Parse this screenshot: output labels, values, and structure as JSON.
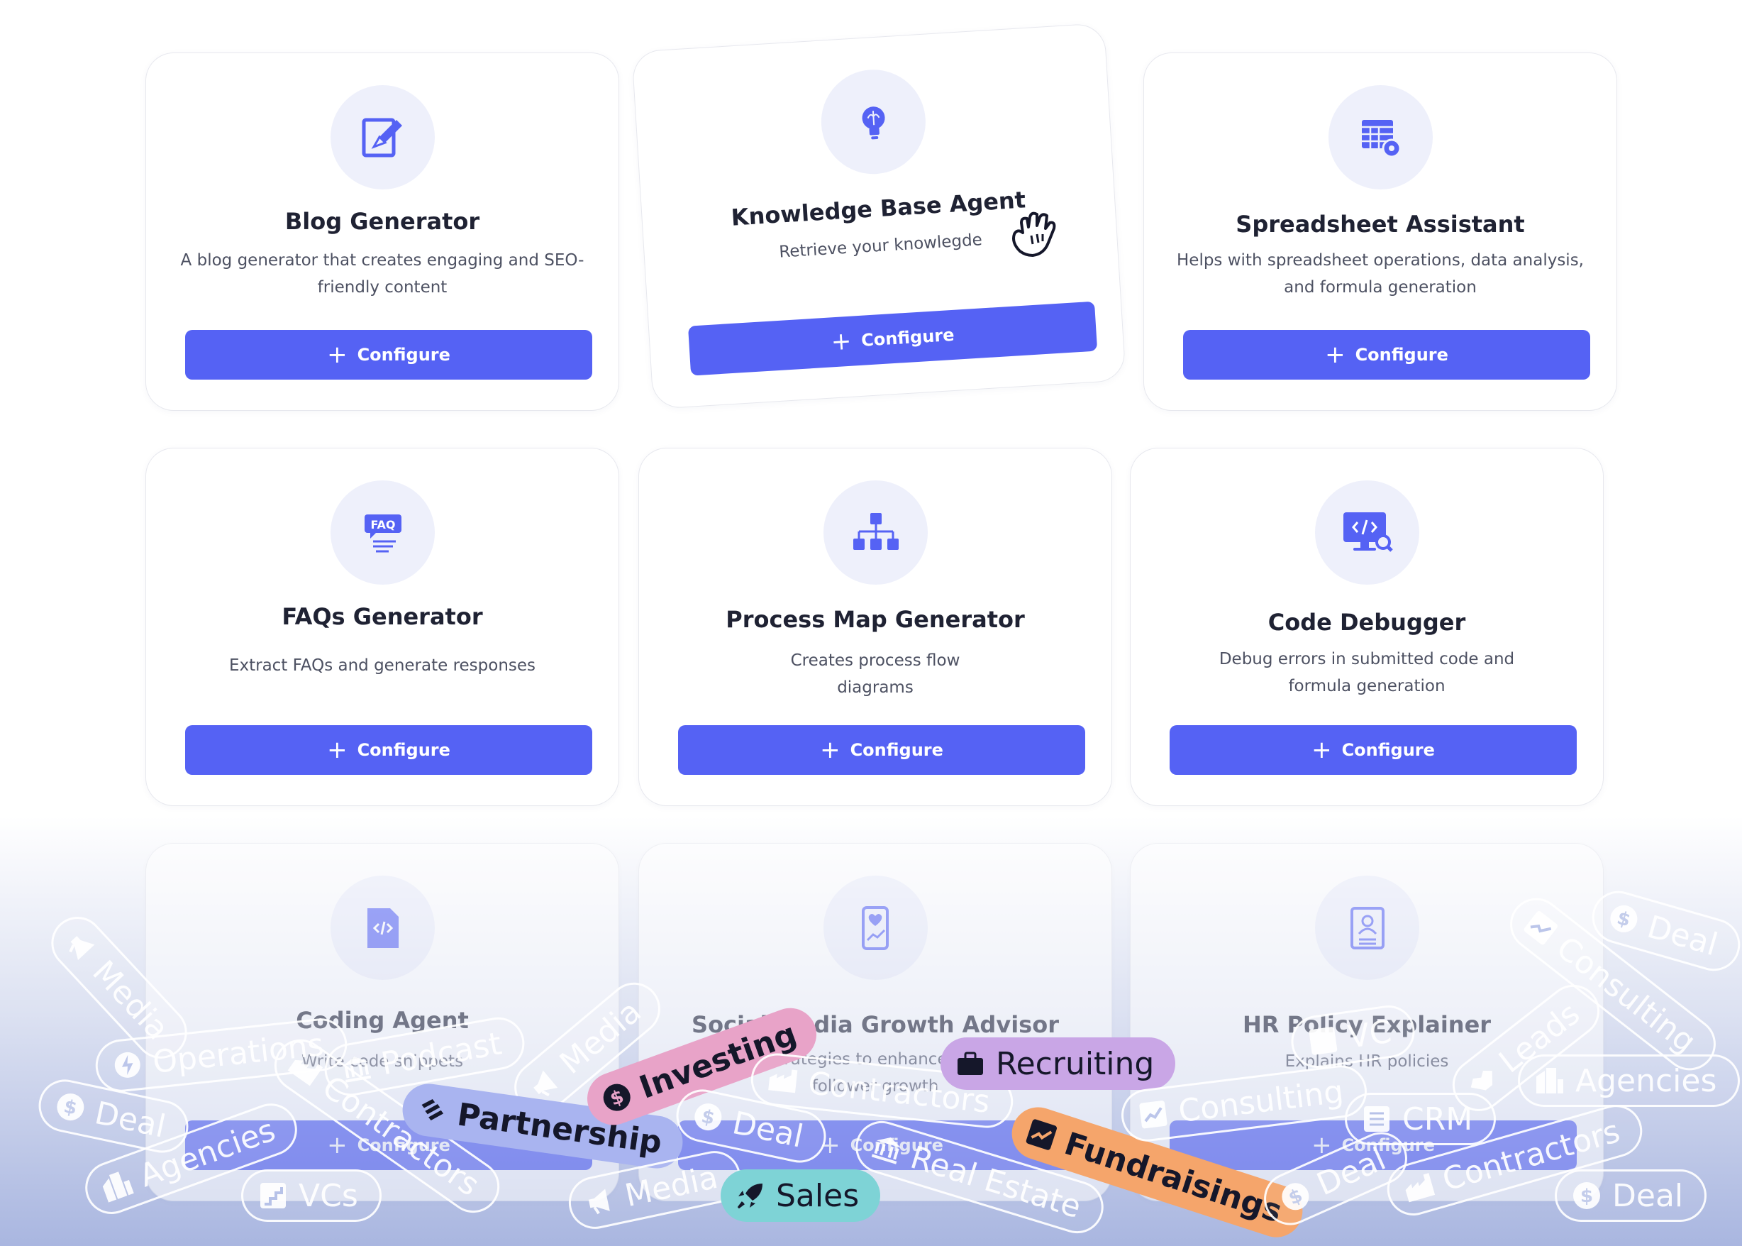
{
  "cards": [
    {
      "title": "Blog Generator",
      "desc": "A blog generator that creates engaging and SEO-friendly content",
      "button": "Configure",
      "icon": "blog-edit-icon"
    },
    {
      "title": "Knowledge Base Agent",
      "desc": "Retrieve your knowlegde",
      "button": "Configure",
      "icon": "lightbulb-brain-icon"
    },
    {
      "title": "Spreadsheet Assistant",
      "desc": "Helps with spreadsheet operations, data analysis, and formula generation",
      "button": "Configure",
      "icon": "spreadsheet-gear-icon"
    },
    {
      "title": "FAQs Generator",
      "desc": "Extract FAQs and generate responses",
      "button": "Configure",
      "icon": "faq-icon"
    },
    {
      "title": "Process Map Generator",
      "desc": "Creates process flow diagrams",
      "button": "Configure",
      "icon": "org-chart-icon"
    },
    {
      "title": "Code Debugger",
      "desc": "Debug errors in submitted code and formula generation",
      "button": "Configure",
      "icon": "code-monitor-search-icon"
    },
    {
      "title": "Coding Agent",
      "desc": "Write code snippets",
      "button": "Configure",
      "icon": "code-file-icon"
    },
    {
      "title": "Social Media Growth Advisor",
      "desc": "Suggests strategies to enhance engagement, follower growth",
      "button": "Configure",
      "icon": "phone-growth-icon"
    },
    {
      "title": "HR Policy Explainer",
      "desc": "Explains HR policies",
      "button": "Configure",
      "icon": "document-person-icon"
    }
  ],
  "tags": {
    "media_1": "Media",
    "operations": "Operations",
    "podcast": "Podcast",
    "media_2": "Media",
    "deal_1": "Deal",
    "contractors_1": "Contractors",
    "partnership": "Partnership",
    "investing": "Investing",
    "agencies_1": "Agencies",
    "vcs": "VCs",
    "media_3": "Media",
    "sales": "Sales",
    "deal_2": "Deal",
    "contractors_2": "Contractors",
    "recruiting": "Recruiting",
    "real_estate": "Real Estate",
    "fundraisings": "Fundraisings",
    "consulting_1": "Consulting",
    "crm": "CRM",
    "deal_3": "Deal",
    "contractors_3": "Contractors",
    "leads": "Leads",
    "agencies_2": "Agencies",
    "consulting_2": "Consulting",
    "deal_4": "Deal",
    "deal_5": "Deal",
    "vc_partial": "VC"
  },
  "colors": {
    "accent": "#5562f4",
    "icon_bg": "#eef0fb",
    "investing": "#e8a3c8",
    "recruiting": "#c9a6e6",
    "partnership": "#a9b4f0",
    "sales": "#7ed3d6",
    "fundraisings": "#f5a56b"
  }
}
